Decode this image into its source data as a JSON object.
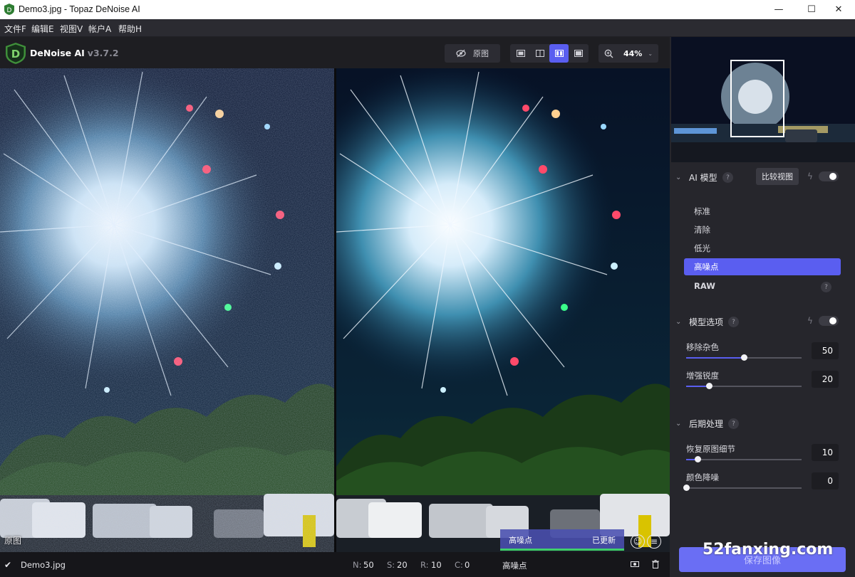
{
  "window": {
    "title": "Demo3.jpg - Topaz DeNoise AI",
    "minimize": "—",
    "maximize": "☐",
    "close": "✕"
  },
  "menu": [
    "文件F",
    "编辑E",
    "视图V",
    "帐户A",
    "帮助H"
  ],
  "brand": {
    "name": "DeNoise AI",
    "version": "v3.7.2"
  },
  "toolbar": {
    "original_label": "原图",
    "zoom": "44%",
    "view_modes": [
      "single-view",
      "split-view",
      "side-by-side-view",
      "quad-view"
    ],
    "selected_view": "side-by-side-view"
  },
  "image": {
    "left_label": "原图",
    "status_model": "高噪点",
    "status_state": "已更新"
  },
  "bottombar": {
    "filename": "Demo3.jpg",
    "n": "N:",
    "n_val": "50",
    "s": "S:",
    "s_val": "20",
    "r": "R:",
    "r_val": "10",
    "c": "C:",
    "c_val": "0",
    "model": "高噪点"
  },
  "panel": {
    "ai_model": {
      "title": "AI 模型",
      "compare_button": "比较视图",
      "items": [
        "标准",
        "清除",
        "低光",
        "高噪点",
        "RAW"
      ],
      "selected": "高噪点"
    },
    "model_options": {
      "title": "模型选项",
      "sliders": [
        {
          "label": "移除杂色",
          "value": "50",
          "fraction": 0.5
        },
        {
          "label": "增强锐度",
          "value": "20",
          "fraction": 0.2
        }
      ]
    },
    "post_processing": {
      "title": "后期处理",
      "sliders": [
        {
          "label": "恢复原图细节",
          "value": "10",
          "fraction": 0.1
        },
        {
          "label": "颜色降噪",
          "value": "0",
          "fraction": 0.0
        }
      ]
    },
    "help": "?",
    "save_button": "保存图像"
  },
  "watermark": "52fanxing.com",
  "colors": {
    "accent": "#5a5ef0",
    "panel": "#26262c",
    "status_green": "#3fcf6a"
  }
}
